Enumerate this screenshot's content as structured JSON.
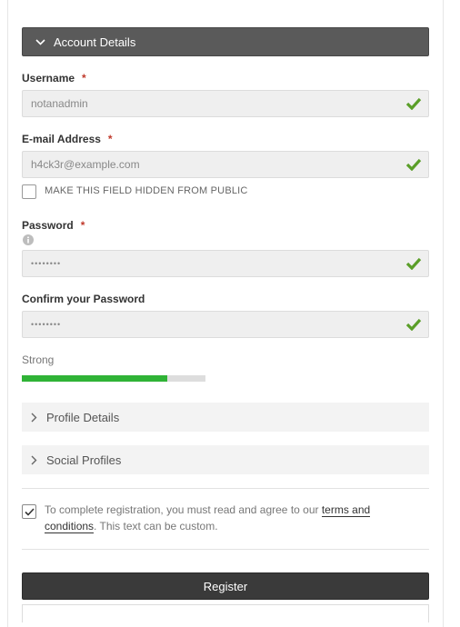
{
  "account_section": {
    "title": "Account Details"
  },
  "username": {
    "label": "Username",
    "required_mark": "*",
    "value": "notanadmin"
  },
  "email": {
    "label": "E-mail Address",
    "required_mark": "*",
    "value": "h4ck3r@example.com",
    "hide_label": "MAKE THIS FIELD HIDDEN FROM PUBLIC",
    "hide_checked": false
  },
  "password": {
    "label": "Password",
    "required_mark": "*",
    "value": "••••••••"
  },
  "confirm_password": {
    "label": "Confirm your Password",
    "value": "••••••••"
  },
  "strength": {
    "text": "Strong",
    "level": 0.79,
    "color": "#2fb336"
  },
  "profile_section": {
    "title": "Profile Details"
  },
  "social_section": {
    "title": "Social Profiles"
  },
  "terms": {
    "checked": true,
    "text_before": "To complete registration, you must read and agree to our ",
    "link": "terms and conditions",
    "text_after": ". This text can be custom."
  },
  "register_button": {
    "label": "Register"
  },
  "colors": {
    "valid_check": "#5a9e28",
    "header_bg": "#5a5a5a",
    "button_bg": "#3a3a3a"
  }
}
